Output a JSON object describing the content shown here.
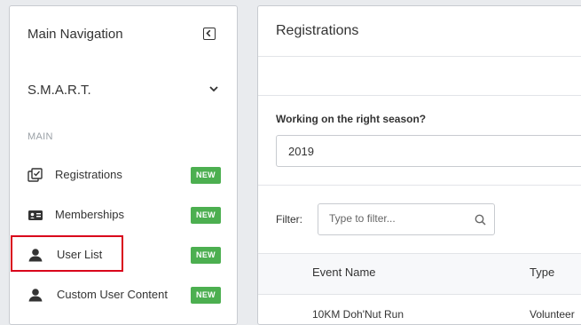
{
  "sidebar": {
    "title": "Main Navigation",
    "org": "S.M.A.R.T.",
    "section": "MAIN",
    "items": [
      {
        "label": "Registrations",
        "badge": "NEW",
        "icon": "registrations-icon"
      },
      {
        "label": "Memberships",
        "badge": "NEW",
        "icon": "membership-card-icon"
      },
      {
        "label": "User List",
        "badge": "NEW",
        "icon": "user-icon"
      },
      {
        "label": "Custom User Content",
        "badge": "NEW",
        "icon": "user-icon"
      }
    ]
  },
  "main": {
    "title": "Registrations",
    "season_question": "Working on the right season?",
    "season_value": "2019",
    "filter_label": "Filter:",
    "filter_placeholder": "Type to filter...",
    "table": {
      "columns": [
        "Event Name",
        "Type"
      ],
      "rows": [
        [
          "10KM Doh'Nut Run",
          "Volunteer"
        ]
      ]
    }
  },
  "colors": {
    "badge": "#4caf50",
    "highlight": "#d9001b"
  }
}
